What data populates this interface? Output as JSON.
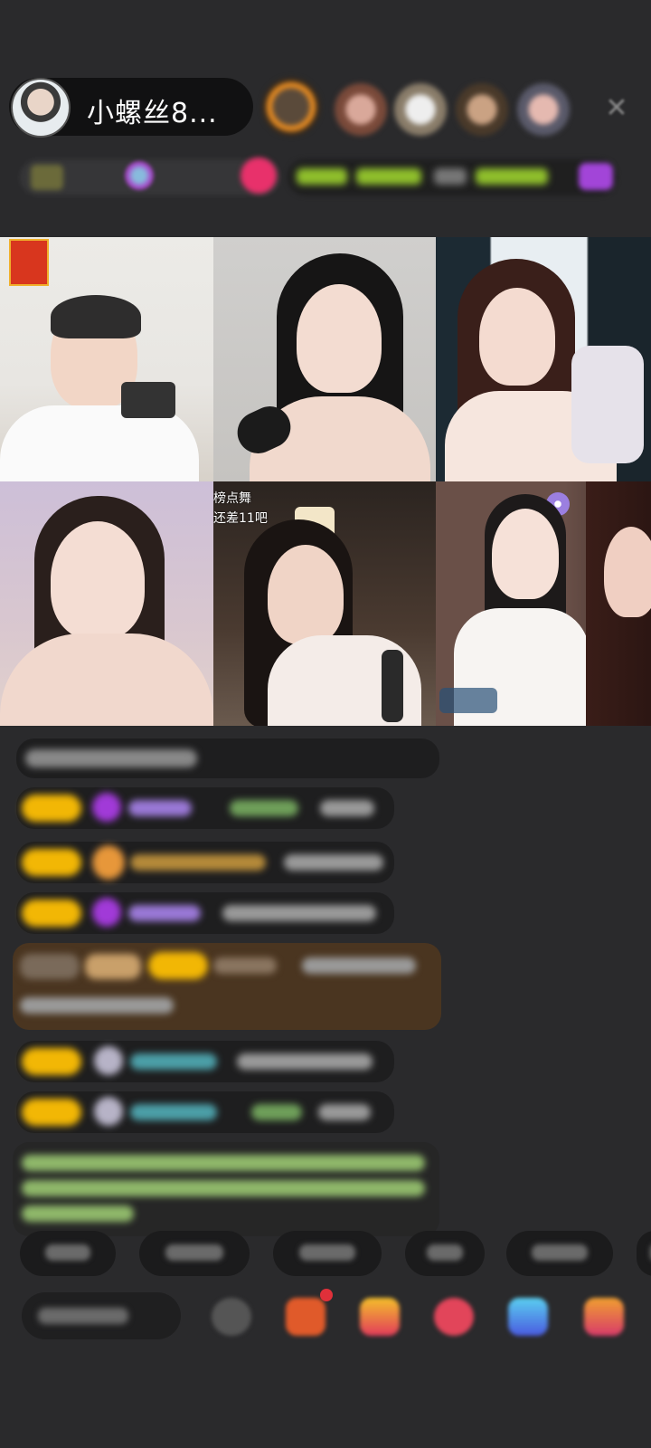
{
  "host": {
    "name": "小螺丝8..."
  },
  "header": {
    "close_icon": "close-icon"
  },
  "video_grid": {
    "tile5_caption_line1": "榜点舞",
    "tile5_caption_line2": "还差11吧"
  },
  "colors": {
    "background": "#2a2a2c",
    "chat_bubble": "#1c1c1d",
    "highlight_bubble": "#4a3520",
    "gold_badge": "#f2b705",
    "green_text": "#9ccf6a"
  }
}
